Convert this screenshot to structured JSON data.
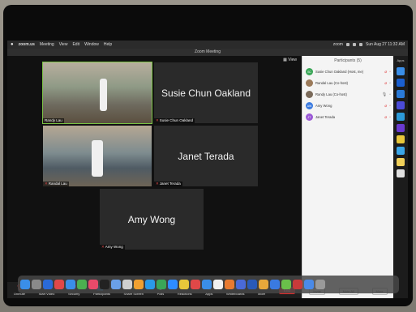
{
  "menubar": {
    "app": "zoom.us",
    "items": [
      "Meeting",
      "View",
      "Edit",
      "Window",
      "Help"
    ],
    "status_right": "zoom",
    "clock": "Sun Aug 27 11:32 AM"
  },
  "window": {
    "title": "Zoom Meeting"
  },
  "view_button": "View",
  "tiles": [
    {
      "name": "Randy Lau",
      "type": "video",
      "speaking": true,
      "muted": false
    },
    {
      "name": "Susie Chun Oakland",
      "type": "name",
      "muted": true
    },
    {
      "name": "Randal Lau",
      "type": "video",
      "muted": true
    },
    {
      "name": "Janet Terada",
      "type": "name",
      "muted": true
    },
    {
      "name": "Amy Wong",
      "type": "name",
      "muted": true
    }
  ],
  "toolbar": {
    "unmute": "Unmute",
    "start_video": "Start Video",
    "security": "Security",
    "participants": "Participants",
    "participants_count": "5",
    "share_screen": "Share Screen",
    "polls": "Polls",
    "reactions": "Reactions",
    "apps": "Apps",
    "whiteboards": "Whiteboards",
    "more": "More",
    "end": "End"
  },
  "participants_panel": {
    "title": "Participants (5)",
    "list": [
      {
        "initials": "SC",
        "name": "Susie Chun Oakland (Host, me)",
        "color": "#3aa657",
        "mic": "off",
        "cam": "off"
      },
      {
        "initials": "",
        "name": "Randal Lau (Co-host)",
        "color": "#9b7a5a",
        "mic": "off",
        "cam": "on"
      },
      {
        "initials": "",
        "name": "Randy Lau (Co-host)",
        "color": "#7a6a5a",
        "mic": "on",
        "cam": "on"
      },
      {
        "initials": "AW",
        "name": "Amy Wong",
        "color": "#3a7ae0",
        "mic": "off",
        "cam": "off"
      },
      {
        "initials": "JT",
        "name": "Janet Terada",
        "color": "#9b59d6",
        "mic": "off",
        "cam": "off"
      }
    ],
    "footer": [
      "Invite",
      "Mute All",
      "More"
    ]
  },
  "apps_panel": {
    "title": "Apps"
  },
  "icons": {
    "apple": "apple-icon",
    "mic_off": "microphone-muted-icon",
    "video_off": "video-off-icon",
    "shield": "shield-icon",
    "people": "people-icon",
    "share": "share-screen-icon",
    "polls": "polls-icon",
    "heart": "reactions-icon",
    "apps": "apps-icon",
    "whiteboard": "whiteboard-icon",
    "more": "more-icon"
  },
  "colors": {
    "accent_green": "#2fbf4a",
    "end_red": "#e02b2b",
    "speaking_border": "#7ac243"
  }
}
